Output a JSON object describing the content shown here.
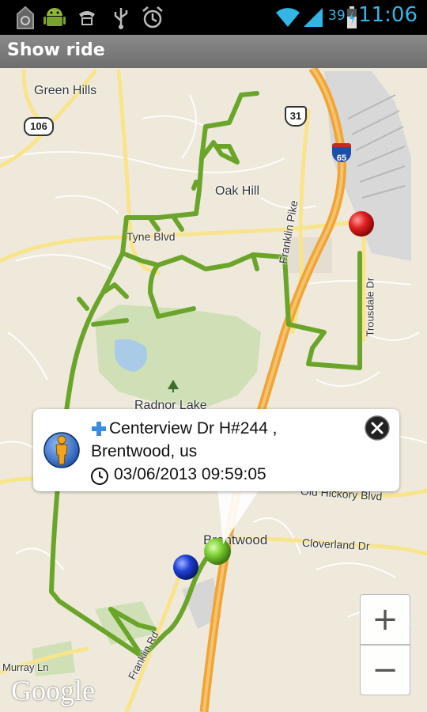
{
  "status_bar": {
    "battery_percent": "39",
    "time": "11:06",
    "icons": [
      "notification-app-icon",
      "android-icon",
      "voicemail-icon",
      "usb-icon",
      "alarm-icon",
      "wifi-icon",
      "signal-icon",
      "battery-icon"
    ]
  },
  "title_bar": {
    "title": "Show ride"
  },
  "map": {
    "labels": {
      "green_hills": "Green Hills",
      "oak_hill": "Oak Hill",
      "tyne_blvd": "Tyne Blvd",
      "franklin_pike": "Franklin Pike",
      "trousdale_dr": "Trousdale Dr",
      "radnor_lake": "Radnor Lake",
      "old_hickory_blvd": "Old Hickory Blvd",
      "brentwood": "Brentwood",
      "cloverland_dr": "Cloverland Dr",
      "murray_ln": "Murray Ln",
      "franklin_rd": "Franklin Rd"
    },
    "shields": {
      "route_106": "106",
      "route_31": "31",
      "interstate_65": "65"
    },
    "markers": [
      {
        "name": "end-marker",
        "color": "#e02020"
      },
      {
        "name": "start-marker",
        "color": "#7acc30"
      },
      {
        "name": "current-marker",
        "color": "#1f3fd6"
      }
    ],
    "route_color": "#6aa52a",
    "attribution": "Google"
  },
  "popup": {
    "location_line_1": "Centerview Dr H#244 ,",
    "location_line_2": "Brentwood, us",
    "timestamp": "03/06/2013 09:59:05"
  },
  "zoom_controls": {
    "zoom_in_label": "+",
    "zoom_out_label": "−"
  }
}
